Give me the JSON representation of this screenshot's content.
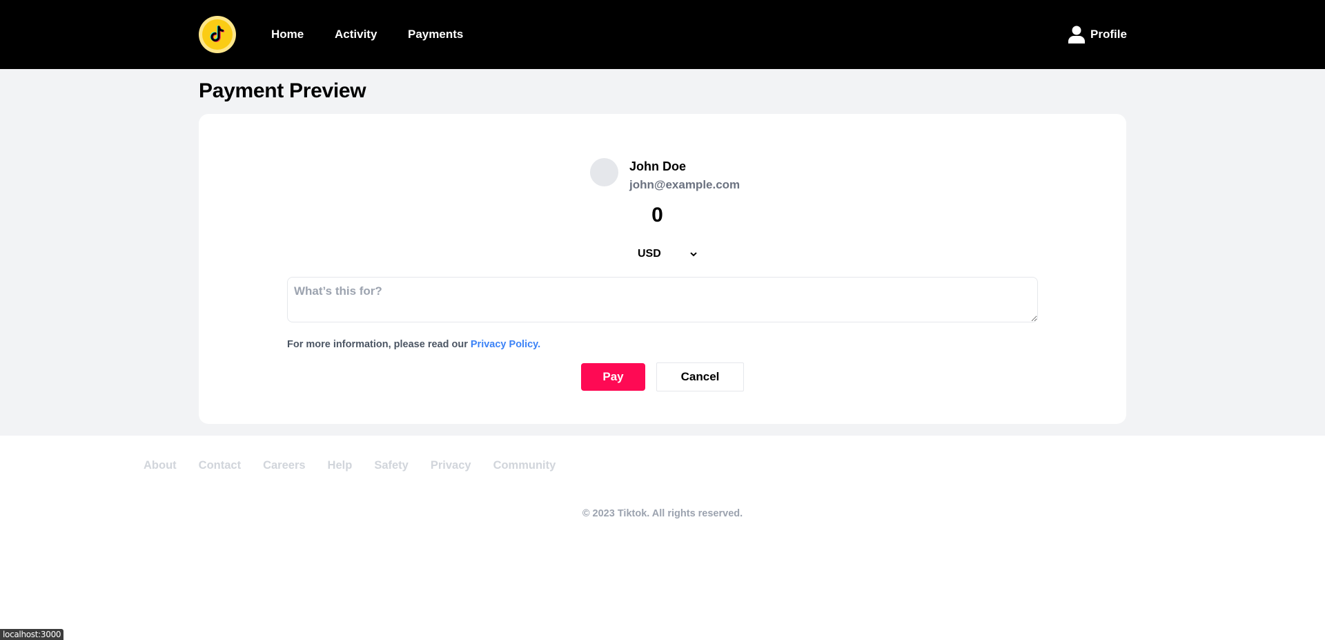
{
  "header": {
    "logo_icon": "tiktok-logo-icon",
    "nav": [
      {
        "label": "Home"
      },
      {
        "label": "Activity"
      },
      {
        "label": "Payments"
      }
    ],
    "profile": {
      "icon": "user-icon",
      "label": "Profile"
    }
  },
  "page": {
    "title": "Payment Preview"
  },
  "payment": {
    "recipient_name": "John Doe",
    "recipient_email": "john@example.com",
    "amount": "0",
    "currency": "USD",
    "note_placeholder": "What’s this for?",
    "note_value": "",
    "info_text": "For more information, please read our ",
    "privacy_link": "Privacy Policy",
    "info_suffix": ".",
    "pay_label": "Pay",
    "cancel_label": "Cancel"
  },
  "footer": {
    "links": [
      "About",
      "Contact",
      "Careers",
      "Help",
      "Safety",
      "Privacy",
      "Community"
    ],
    "copyright": "© 2023 Tiktok. All rights reserved."
  },
  "statusbar": {
    "url": "localhost:3000"
  },
  "colors": {
    "header_bg": "#000000",
    "logo_yellow": "#facc15",
    "pay_button": "#fe0a54",
    "link_blue": "#3b82f6",
    "page_bg": "#f2f3f5"
  }
}
